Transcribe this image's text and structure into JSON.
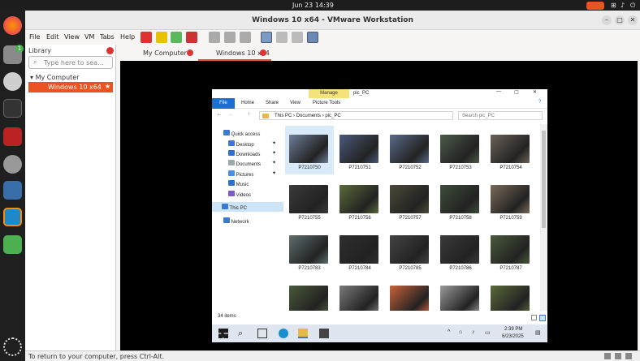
{
  "topbar": {
    "activities": "",
    "clock": "Jun 23  14:39"
  },
  "dock": {
    "items": [
      "firefox-icon",
      "files-icon",
      "chat-icon",
      "terminal-icon",
      "recorder-icon",
      "disk-icon",
      "monitor-icon",
      "vmware-icon",
      "recycle-icon",
      "apps-grid-icon"
    ],
    "files_badge": "1"
  },
  "vmware": {
    "title": "Windows 10 x64 - VMware Workstation",
    "menu": [
      "File",
      "Edit",
      "View",
      "VM",
      "Tabs",
      "Help"
    ],
    "library": {
      "title": "Library",
      "search_placeholder": "Type here to sea...",
      "my_computer": "My Computer",
      "vm_name": "Windows 10 x64"
    },
    "tabs": [
      {
        "label": "My Computer"
      },
      {
        "label": "Windows 10 x64"
      }
    ],
    "status": "To return to your computer, press Ctrl-Alt."
  },
  "explorer": {
    "ribbon_context": "Manage",
    "ribbon_context_title": "pic_PC",
    "ribbon_tabs": [
      "File",
      "Home",
      "Share",
      "View",
      "Picture Tools"
    ],
    "breadcrumb": [
      "This PC",
      "Documents",
      "pic_PC"
    ],
    "search_placeholder": "Search pic_PC",
    "nav": [
      {
        "label": "Quick access",
        "pinned": false
      },
      {
        "label": "Desktop",
        "pinned": true
      },
      {
        "label": "Downloads",
        "pinned": true
      },
      {
        "label": "Documents",
        "pinned": true
      },
      {
        "label": "Pictures",
        "pinned": true
      },
      {
        "label": "Music",
        "pinned": false
      },
      {
        "label": "Videos",
        "pinned": false
      },
      {
        "label": "This PC",
        "pinned": false
      },
      {
        "label": "Network",
        "pinned": false
      }
    ],
    "files": [
      {
        "name": "P7210750",
        "color": "#6d7d98"
      },
      {
        "name": "P7210751",
        "color": "#4a5a7a"
      },
      {
        "name": "P7210752",
        "color": "#5a6a8a"
      },
      {
        "name": "P7210753",
        "color": "#4c5a4a"
      },
      {
        "name": "P7210754",
        "color": "#6a6258"
      },
      {
        "name": "P7210755",
        "color": "#3a3a3a"
      },
      {
        "name": "P7210756",
        "color": "#5a6a3a"
      },
      {
        "name": "P7210757",
        "color": "#4a4a38"
      },
      {
        "name": "P7210758",
        "color": "#3e4e3a"
      },
      {
        "name": "P7210759",
        "color": "#7a6a58"
      },
      {
        "name": "P7210783",
        "color": "#5e6e6e"
      },
      {
        "name": "P7210784",
        "color": "#2e2e2e"
      },
      {
        "name": "P7210785",
        "color": "#444444"
      },
      {
        "name": "P7210786",
        "color": "#3a3a3a"
      },
      {
        "name": "P7210787",
        "color": "#4a5a3a"
      },
      {
        "name": "",
        "color": "#4a5a3a"
      },
      {
        "name": "",
        "color": "#7a7a7a"
      },
      {
        "name": "",
        "color": "#c8623a"
      },
      {
        "name": "",
        "color": "#9a9a9a"
      },
      {
        "name": "",
        "color": "#5a6a3a"
      }
    ],
    "item_count": "34 items",
    "taskbar_time": "2:39 PM",
    "taskbar_date": "6/23/2025"
  }
}
